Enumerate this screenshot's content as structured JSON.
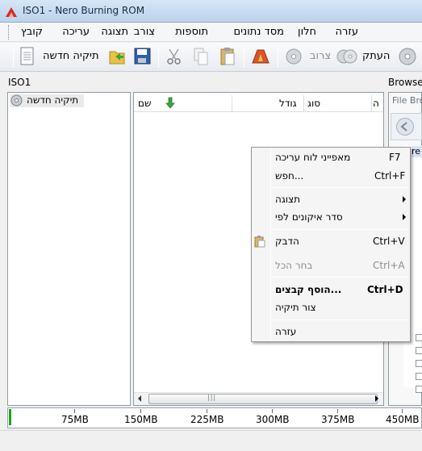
{
  "window": {
    "title": "ISO1 - Nero Burning ROM"
  },
  "menubar": {
    "items": [
      "קובץ",
      "עריכה",
      "תצוגה",
      "צורב",
      "תוספות",
      "מסד נתונים",
      "חלון",
      "עזרה"
    ]
  },
  "toolbar": {
    "new_compilation_label": "תיקיה חדשה",
    "copy_label": "העתק",
    "burn_label": "צרוב",
    "icons": [
      "new-document-icon",
      "new-compilation-icon",
      "save-icon",
      "cut-icon",
      "copy-icon",
      "paste-icon",
      "burn-icon",
      "disc-icon",
      "copy-disc-icon",
      "dvd-icon"
    ]
  },
  "left_panel": {
    "title": "ISO1",
    "tree_root": "תיקיה חדשה"
  },
  "file_list": {
    "columns": [
      "שם",
      "גודל",
      "סוג",
      "ה"
    ]
  },
  "browser": {
    "title": "Browser",
    "tab": "File Bro",
    "tab_fragment": "re"
  },
  "capacity": {
    "labels": [
      "75MB",
      "150MB",
      "225MB",
      "300MB",
      "375MB",
      "450MB"
    ],
    "used_fraction": 0.01
  },
  "context_menu": {
    "items": [
      {
        "label": "מאפייני לוח עריכה",
        "shortcut": "F7"
      },
      {
        "label": "חפש...",
        "shortcut": "Ctrl+F"
      },
      {
        "label": "תצוגה",
        "shortcut": ""
      },
      {
        "label": "סדר איקונים לפי",
        "shortcut": ""
      },
      {
        "label": "הדבק",
        "shortcut": "Ctrl+V"
      },
      {
        "label": "בחר הכל",
        "shortcut": "Ctrl+A"
      },
      {
        "label": "הוסף קבצים...",
        "shortcut": "Ctrl+D"
      },
      {
        "label": "צור תיקיה",
        "shortcut": ""
      },
      {
        "label": "עזרה",
        "shortcut": ""
      }
    ]
  },
  "colors": {
    "capacity_fill": "#1aa61a",
    "title_bar": "#c8dbf0"
  }
}
